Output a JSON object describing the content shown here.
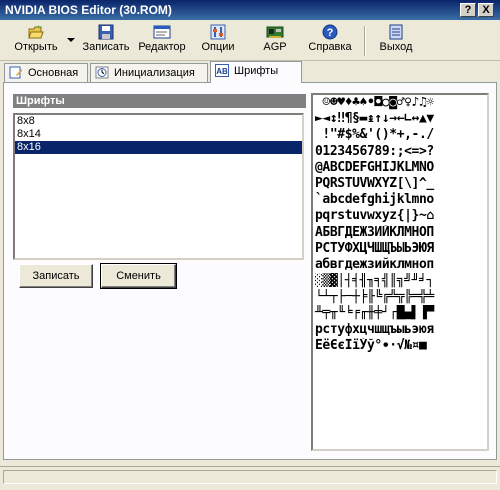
{
  "window": {
    "title": "NVIDIA BIOS Editor (30.ROM)",
    "help_btn": "?",
    "close_btn": "X"
  },
  "toolbar": {
    "open": "Открыть",
    "save": "Записать",
    "editor": "Редактор",
    "options": "Опции",
    "agp": "AGP",
    "help": "Справка",
    "exit": "Выход"
  },
  "tabs": [
    "Основная",
    "Инициализация",
    "Шрифты"
  ],
  "fonts": {
    "header": "Шрифты",
    "items": [
      "8x8",
      "8x14",
      "8x16"
    ],
    "selected_index": 2,
    "save_button": "Записать",
    "change_button": "Сменить",
    "glyph_rows": [
      " ☺☻♥♦♣♠•◘○◙♂♀♪♫☼",
      "►◄↕‼¶§▬↨↑↓→←∟↔▲▼",
      " !\"#$%&'()*+,-./",
      "0123456789:;<=>?",
      "@ABCDEFGHIJKLMNO",
      "PQRSTUVWXYZ[\\]^_",
      "`abcdefghijklmno",
      "pqrstuvwxyz{|}~⌂",
      "АБВГДЕЖЗИЙКЛМНОП",
      "РСТУФХЦЧШЩЪЫЬЭЮЯ",
      "абвгдежзийклмноп",
      "░▒▓│┤╡╢╖╕╣║╗╝╜╛┐",
      "└┴┬├─┼╞╟╚╔╩╦╠═╬╧",
      "╨╤╥╙╘╒╓╫╪┘┌█▄▌▐▀",
      "рстуфхцчшщъыьэюя",
      "ЁёЄєЇїЎў°∙·√№¤■ "
    ]
  },
  "colors": {
    "titlebar": "#0a246a",
    "selection": "#0a246a",
    "section_header": "#808080"
  }
}
